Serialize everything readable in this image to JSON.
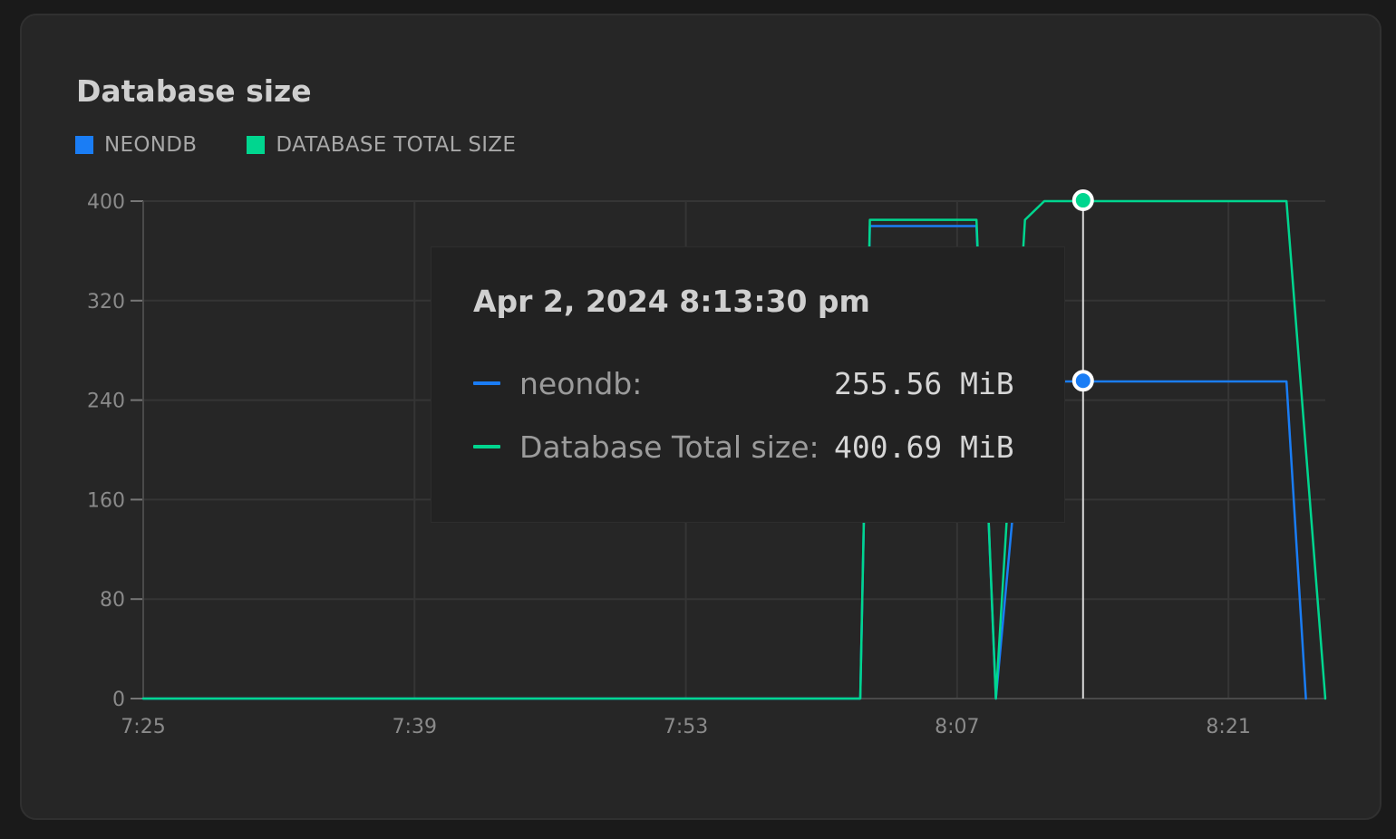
{
  "colors": {
    "neondb": "#1a7df5",
    "total": "#00d68f",
    "grid": "#353535",
    "axis": "#4a4a4a",
    "crosshair": "#d9d9d9"
  },
  "chart_data": {
    "type": "line",
    "title": "Database size",
    "xlabel": "",
    "ylabel": "",
    "xlim": [
      "7:25",
      "8:26"
    ],
    "ylim": [
      0,
      400
    ],
    "y_ticks": [
      0,
      80,
      160,
      240,
      320,
      400
    ],
    "x_ticks": [
      "7:25",
      "7:39",
      "7:53",
      "8:07",
      "8:21"
    ],
    "grid": true,
    "legend_position": "top-left",
    "series": [
      {
        "name": "NEONDB",
        "color": "#1a7df5",
        "points": [
          [
            "7:25",
            0
          ],
          [
            "8:02",
            0
          ],
          [
            "8:02:30",
            380
          ],
          [
            "8:08",
            380
          ],
          [
            "8:09",
            0
          ],
          [
            "8:10:30",
            255
          ],
          [
            "8:24",
            255
          ],
          [
            "8:25",
            0
          ]
        ]
      },
      {
        "name": "DATABASE TOTAL SIZE",
        "color": "#00d68f",
        "points": [
          [
            "7:25",
            0
          ],
          [
            "8:02",
            0
          ],
          [
            "8:02:30",
            385
          ],
          [
            "8:08",
            385
          ],
          [
            "8:09",
            0
          ],
          [
            "8:10:30",
            385
          ],
          [
            "8:11:30",
            400
          ],
          [
            "8:24",
            400
          ],
          [
            "8:26",
            0
          ]
        ]
      }
    ]
  },
  "tooltip": {
    "title": "Apr 2, 2024 8:13:30 pm",
    "rows": [
      {
        "label": "neondb:",
        "value": "255.56 MiB"
      },
      {
        "label": "Database Total size:",
        "value": "400.69 MiB"
      }
    ]
  }
}
